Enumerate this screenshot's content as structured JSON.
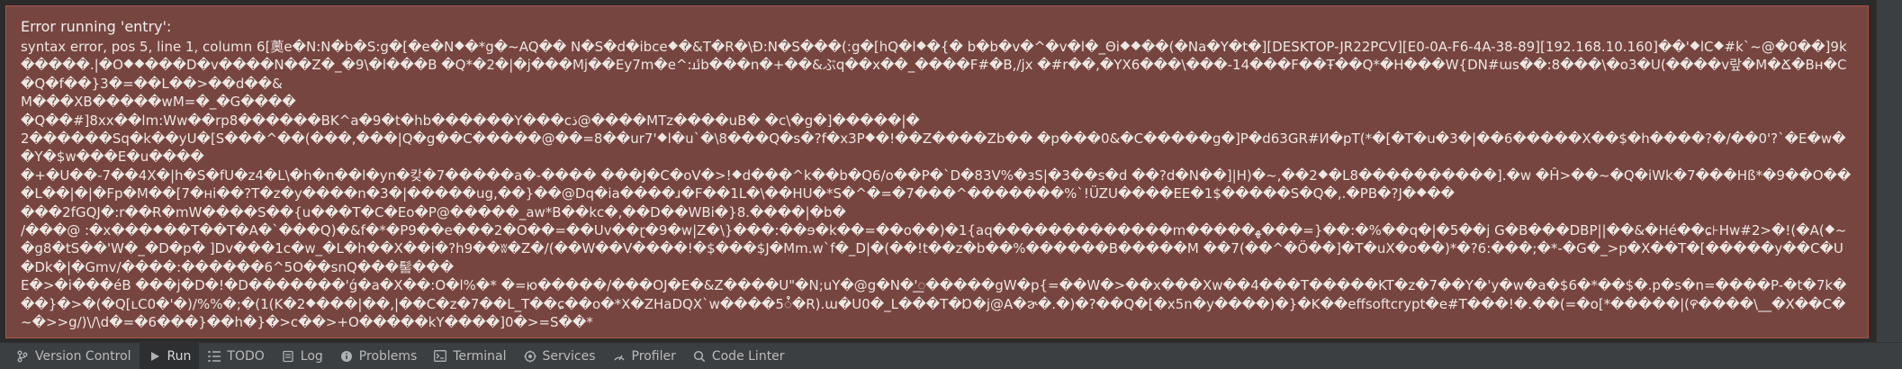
{
  "error": {
    "title": "Error running 'entry':",
    "message": "syntax error, pos 5, line 1, column 6[薁e�N:N�b�S:g�[�e�N⯁�*g�~AQ�� N�S�d�ibce⯁�&T�R�\\Ð:N�S���(:g�[hQ�l⯁�{� b�b�v�^�v�l�_Θi⯁⯁��(�Na�Y�t�][DESKTOP-JR22PCV][E0-0A-F6-4A-38-89][192.168.10.160]��'⯁lC⯁#k`~@�0��]9k�����.|�O⯁⯁���D�v����N��Z�_�9\\�l���B �Q*�2�|�j���Mj��Ey7m�e^:ﯻb���n�+��&ぶq��x��_����F#�B,/jx �#r��,�YX6���\\���-14���F��Ŧ��Q*�H���W{DN#ɯs��:8���\\�o3�U(����v랖�M�Ճ�Bʜ�C�Q�f��}3�=��L��>��d��&\nM���XB�����wM=�_�G����\n�Q��#]8xx��lm:Ww��rp8������BK^a�9�t�hb������Y���cذ@����MTz����uB� �c\\�g�]�����|�\n2������Sq�k��yU�[S���^��(���,���|Q�g��C�����@��=8��ur7'⯁l�u`�\\8���Q�s�?f�x3P⯁�!��Z����Zb�� �p���0&�C�����g�]P�d63GR#И�pT(*�[�T�u�3�|��6�����X��$�h����?�/��0'?`�E�w��Y�$w���E�u����\n�+�U��-7��4X�|h�S�fU�z4�L\\�h�n��l�yn�캊�7�����a�-���� ���J�C�oV�>!⯁d���^k��b�Q6/o��P�`D�83V%�ɜS|�3��s�d ��?d�N��]|H)�~,��2⯁�L8����������].�w �Ĥ>��~�Q�iWk�7���Hß*�9��O���L��|�|�Fp�M��[7�нi��?T�z�y����n�3�|�����ug,��}��@Dq�ia����ɹ�F��1L�\\��HU�*S�^�=�7���^�������%`!ÜZU����EE�1$�����S�Q�,.�PB�?J�⯁��\n���2fGQJ�:r��Ɍ�mW����S��{u���T�C�Eo�P@�����_aw*B��kc�,��D��WBi�}8.����|�b�\n/���@ :�x���⯁��T��T�A�`���Q)�&f�*�P9��e���2�O��=��Uv��ɽ�9�w|Z�\\}���:��ɘ�k��=��o��)�1{aq�������������m�����ﻬ���=}��:�%��q�|�5��j G�B���DBP||��&�Hé��ɕ⊦Hw#2>�!(�A(⯁~�g8�tS��'W�_�D�p� ]Dv���1c�w_�L�h��X��i�?h9��ʬ�Z�/(��W��V����!�$���$J�Mm.w`f�_D|�(��!t��z�b��%������B�����M ��7(��^�Ö��]�T�uX�o��)*�?6:���;�*-�G�_>p�X��T�[�����y��C�U�Dk�|�Gmv/����:������6^5O��snQ���髻���\nE�>�i���éB ���j�D�!�D�������'ǵ�a�X��:O�l%�* �=ю�����/���OJ�E�&Z����U\"�N;uY�@g�N�'꯭�����gW�p{=��W�>��x���Xw��4���T�����KT�z�7��Y�'y�w�a�$6�*��$�.p�s�n=����P-�t�7k���}�>�(�Q[ʟC0�'�)/%%�;�(1(K�2⯁���|��,|��C�z�7��L_T��ɕ��o�*X�ZHaDQX`w����5ꯪ�R).ɯ�U0�_L���T�Ɒ�j@A�ɚ�.�)�?��Q�[�x5n�y����)�}�K��effsoftcrypt�e#T���!�.��(=�o[*�����|(꯵����\\__�X��C�~�>>g/)\\/\\d�=�6���}��h�}�>c��>+O�����kY����]0�>=S��*"
  },
  "toolbar": {
    "tabs": [
      {
        "label": "Version Control",
        "icon": "branch-icon"
      },
      {
        "label": "Run",
        "icon": "play-icon",
        "active": true
      },
      {
        "label": "TODO",
        "icon": "list-icon"
      },
      {
        "label": "Log",
        "icon": "document-icon"
      },
      {
        "label": "Problems",
        "icon": "info-icon"
      },
      {
        "label": "Terminal",
        "icon": "terminal-icon"
      },
      {
        "label": "Services",
        "icon": "services-icon"
      },
      {
        "label": "Profiler",
        "icon": "profiler-icon"
      },
      {
        "label": "Code Linter",
        "icon": "search-icon"
      }
    ]
  },
  "colors": {
    "popup_background": "#774540",
    "popup_border": "#a9534c",
    "toolbar_background": "#3c3f41",
    "active_tab_background": "#2d2f30",
    "text": "#bbbbbb"
  }
}
